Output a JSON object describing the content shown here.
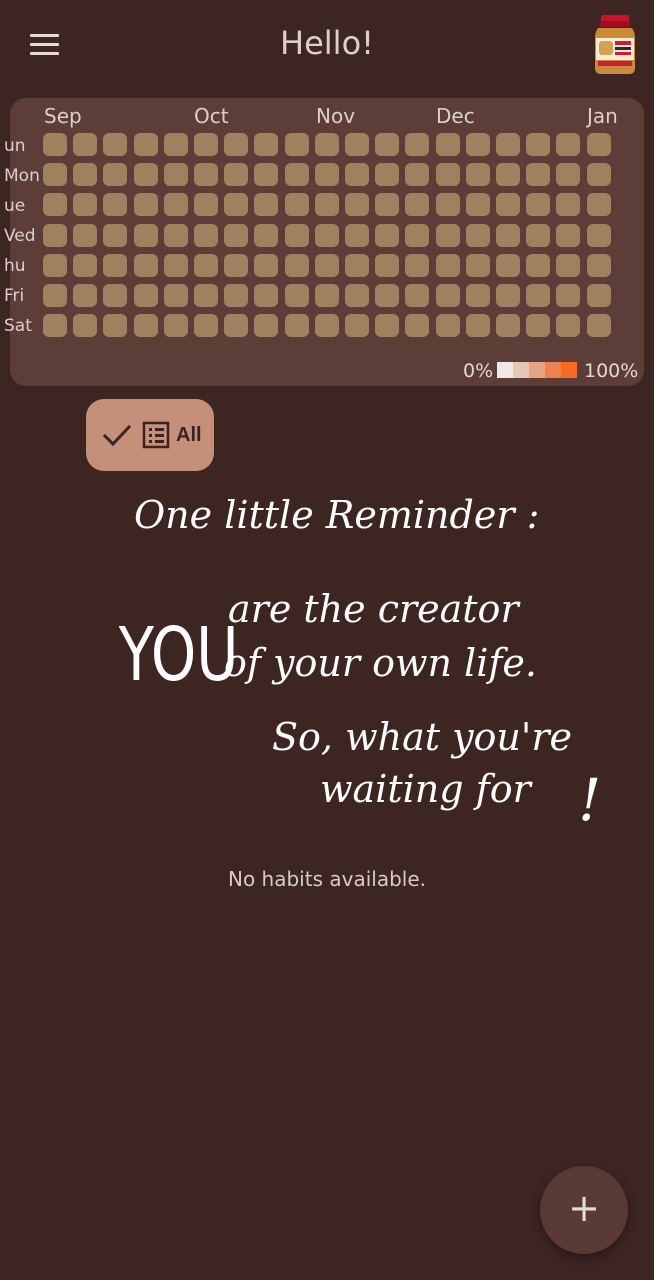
{
  "app_bar": {
    "title": "Hello!",
    "menu_icon": "hamburger-menu-icon",
    "avatar_icon": "peanut-butter-jar-icon"
  },
  "heatmap": {
    "months": [
      "Sep",
      "Oct",
      "Nov",
      "Dec",
      "Jan"
    ],
    "days": [
      "Sun",
      "Mon",
      "Tue",
      "Wed",
      "Thu",
      "Fri",
      "Sat"
    ],
    "day_labels_shown": [
      "un",
      "Mon",
      "ue",
      "Ved",
      "hu",
      "Fri",
      "Sat"
    ],
    "weeks": 19,
    "cell_color": "#9e8260",
    "legend": {
      "min_label": "0%",
      "max_label": "100%",
      "colors": [
        "#efe9e6",
        "#e6c6b4",
        "#e4a484",
        "#ec8250",
        "#f56a24"
      ]
    }
  },
  "filter_chip": {
    "label": "All",
    "icons": [
      "check-icon",
      "list-icon"
    ],
    "selected": true
  },
  "reminder_note": {
    "line1": "One little Reminder :",
    "big_word": "YOU",
    "line2": "are the creator",
    "line3": "of your own life.",
    "line4": "So, what you're",
    "line5": "waiting for",
    "ending": "!"
  },
  "empty_state": "No habits available.",
  "fab": {
    "label": "+",
    "icon": "add-icon"
  },
  "colors": {
    "background": "#3d2522",
    "card": "#5c3d37",
    "chip": "#c4907a",
    "fab": "#5a3a34"
  }
}
